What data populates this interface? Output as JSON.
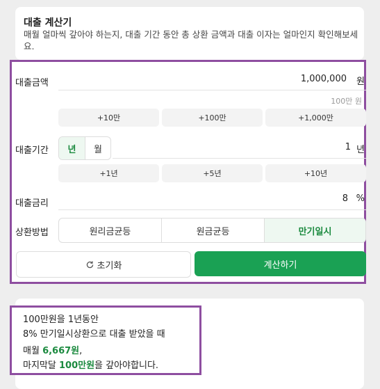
{
  "header": {
    "title": "대출 계산기",
    "description": "매월 얼마씩 갚아야 하는지, 대출 기간 동안 총 상환 금액과 대출 이자는 얼마인지 확인해보세요."
  },
  "amount": {
    "label": "대출금액",
    "value": "1,000,000",
    "unit": "원",
    "hint": "100만 원",
    "chips": [
      "+10만",
      "+100만",
      "+1,000만"
    ]
  },
  "period": {
    "label": "대출기간",
    "units": [
      "년",
      "월"
    ],
    "selected_unit": "년",
    "value": "1",
    "unit": "년",
    "chips": [
      "+1년",
      "+5년",
      "+10년"
    ]
  },
  "rate": {
    "label": "대출금리",
    "value": "8",
    "unit": "%"
  },
  "method": {
    "label": "상환방법",
    "options": [
      "원리금균등",
      "원금균등",
      "만기일시"
    ],
    "selected": "만기일시"
  },
  "buttons": {
    "reset": "초기화",
    "calculate": "계산하기"
  },
  "result": {
    "line1": "100만원을 1년동안",
    "line2": "8% 만기일시상환으로 대출 받았을 때",
    "monthly_prefix": "매월 ",
    "monthly_amount": "6,667원",
    "monthly_suffix": ",",
    "final_prefix": "마지막달 ",
    "final_amount": "100만원",
    "final_suffix": "을 갚아야합니다."
  },
  "colors": {
    "accent": "#1aa154",
    "highlight_border": "#8e4ea0"
  }
}
